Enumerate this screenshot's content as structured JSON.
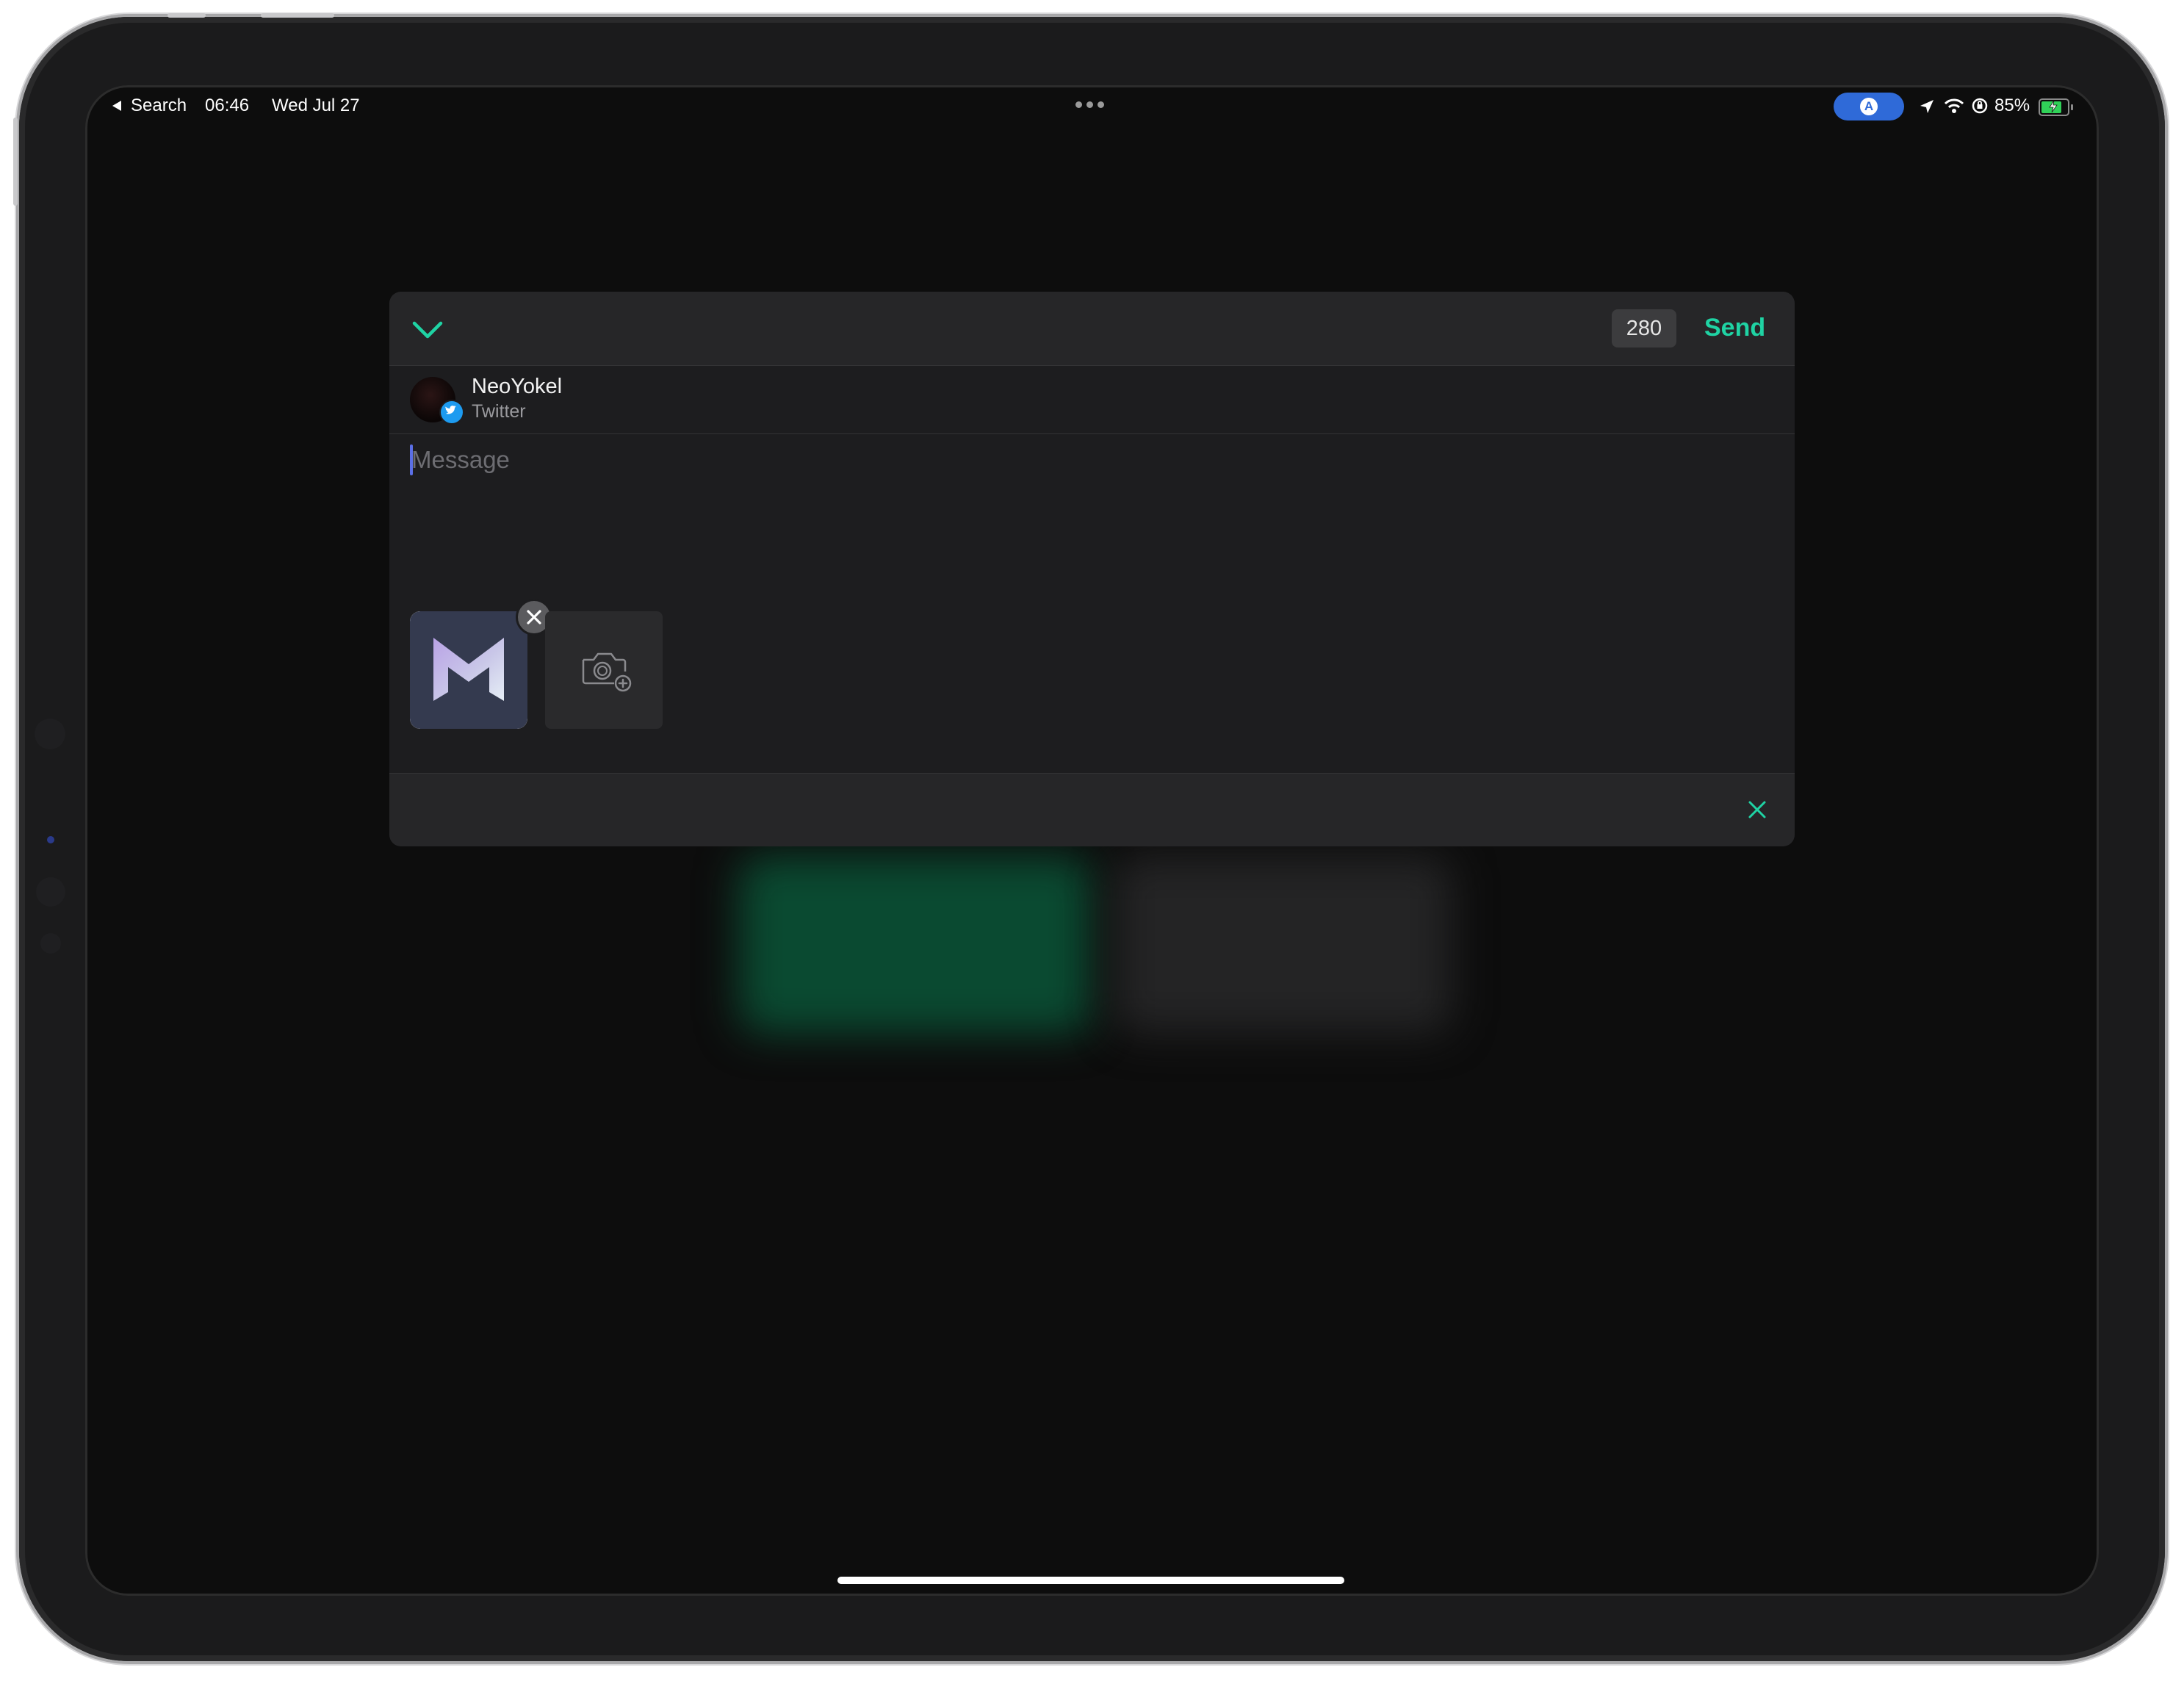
{
  "status_bar": {
    "back_label": "Search",
    "time": "06:46",
    "date": "Wed Jul 27",
    "pill_letter": "A",
    "battery": "85%",
    "battery_level": 0.85
  },
  "compose": {
    "char_count": "280",
    "send_label": "Send",
    "account": {
      "name": "NeoYokel",
      "service": "Twitter"
    },
    "message_placeholder": "Message"
  },
  "colors": {
    "accent": "#1fd3a4",
    "twitter": "#1d9bf0",
    "status_pill": "#2f6ad8",
    "battery_fill": "#30d158"
  },
  "icons": {
    "collapse": "chevron-down-icon",
    "twitter_badge": "twitter-icon",
    "remove_attachment": "close-icon",
    "add_media": "camera-add-icon",
    "dismiss": "close-icon"
  }
}
